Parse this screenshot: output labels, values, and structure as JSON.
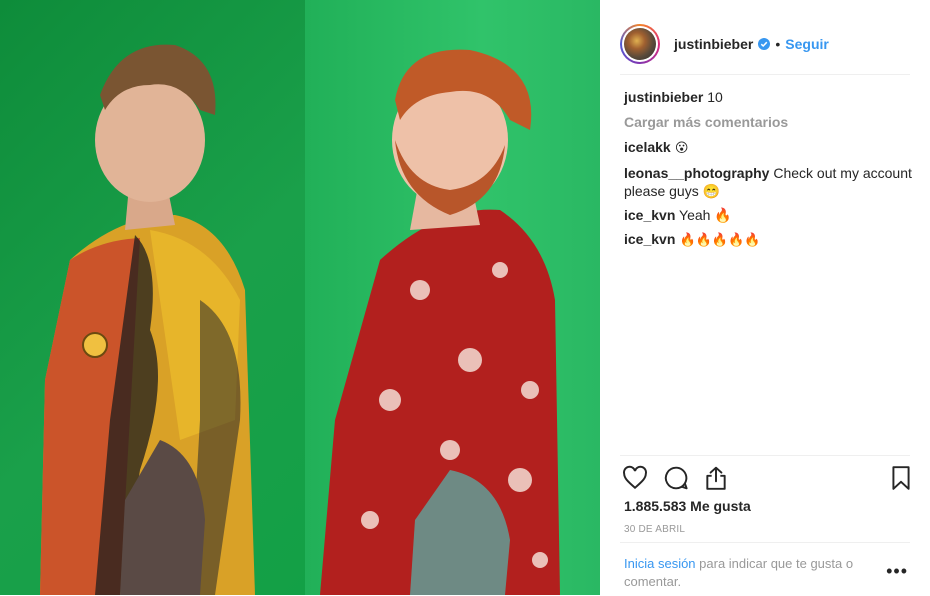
{
  "post": {
    "author": "justinbieber",
    "follow_label": "Seguir",
    "separator": "•"
  },
  "comments": {
    "caption_user": "justinbieber",
    "caption_text": " 10",
    "load_more": "Cargar más comentarios",
    "items": [
      {
        "user": "icelakk",
        "text": " 😮"
      },
      {
        "user": "leonas__photography",
        "text": " Check out my account please guys 😁"
      },
      {
        "user": "ice_kvn",
        "text": " Yeah 🔥"
      },
      {
        "user": "ice_kvn",
        "text": " 🔥🔥🔥🔥🔥"
      }
    ]
  },
  "stats": {
    "likes": "1.885.583 Me gusta",
    "date": "30 DE ABRIL"
  },
  "login": {
    "link": "Inicia sesión",
    "text": " para indicar que te gusta o comentar.",
    "more": "•••"
  },
  "icons": {
    "like": "heart-icon",
    "comment": "comment-icon",
    "share": "share-icon",
    "save": "bookmark-icon",
    "verified": "verified-badge-icon"
  },
  "colors": {
    "link": "#3897f0",
    "muted": "#999999",
    "text": "#262626",
    "green_screen": "#2aa84a"
  }
}
